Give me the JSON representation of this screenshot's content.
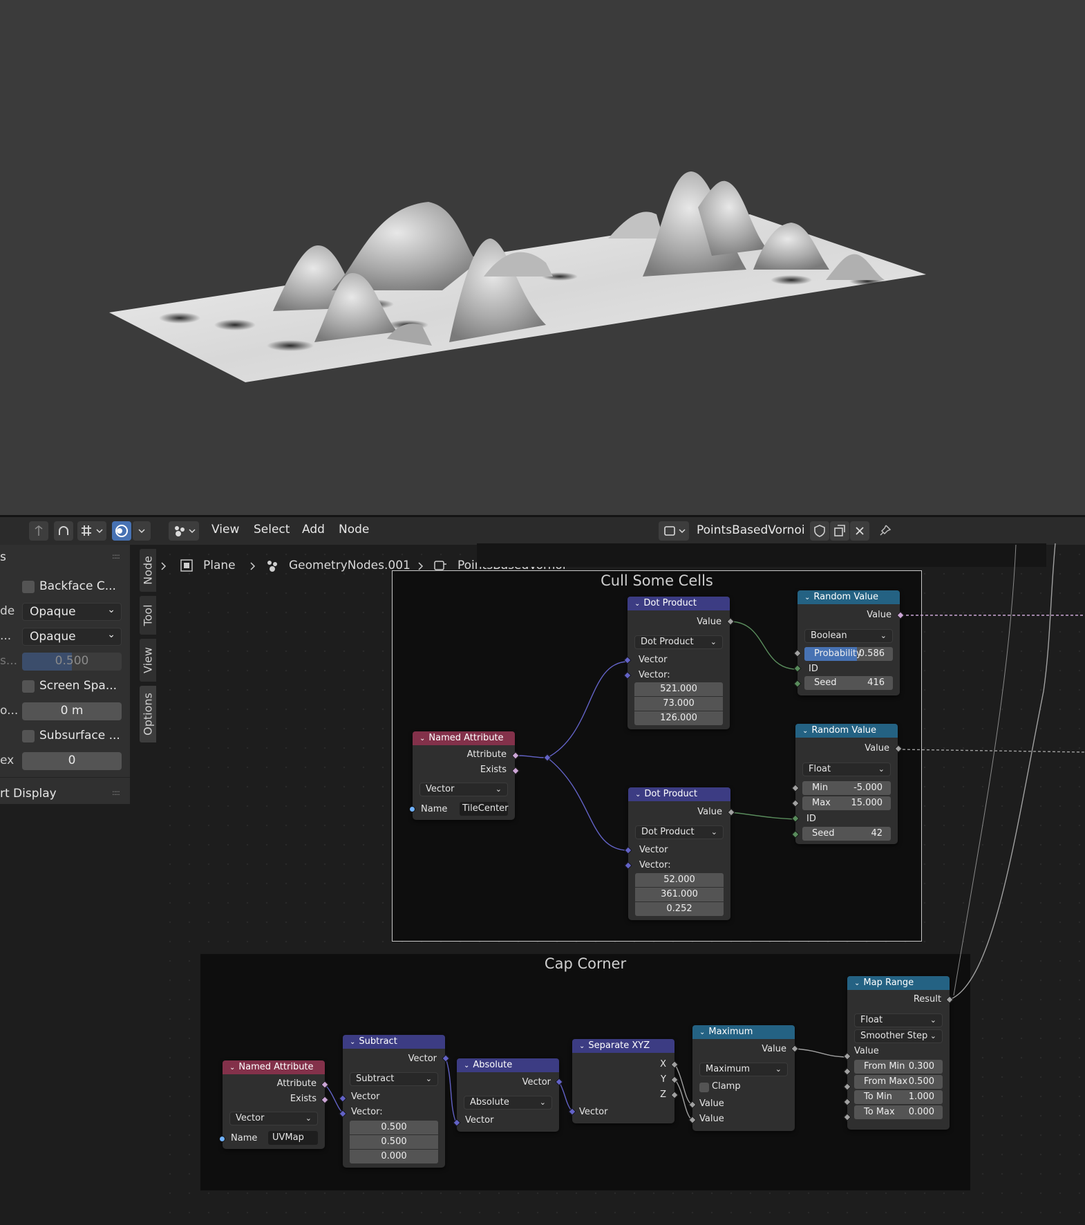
{
  "header": {
    "menus": [
      "View",
      "Select",
      "Add",
      "Node"
    ],
    "tree_name": "PointsBasedVornoi"
  },
  "breadcrumb": {
    "object": "Plane",
    "modifier": "GeometryNodes.001",
    "tree": "PointsBasedVornoi"
  },
  "sidepanel": {
    "title": "s",
    "rows": [
      {
        "label": "",
        "checkbox": "Backface C..."
      },
      {
        "label": "de",
        "value": "Opaque"
      },
      {
        "label": "...",
        "value": "Opaque"
      },
      {
        "label": "s...",
        "value": "0.500"
      },
      {
        "label": "",
        "checkbox": "Screen Spa..."
      },
      {
        "label": "o...",
        "value": "0 m"
      },
      {
        "label": "",
        "checkbox": "Subsurface ..."
      },
      {
        "label": "ex",
        "value": "0"
      }
    ],
    "section2": "rt Display"
  },
  "tabs": [
    "Node",
    "Tool",
    "View",
    "Options"
  ],
  "frames": {
    "cull": "Cull Some Cells",
    "cap": "Cap Corner"
  },
  "nodes": {
    "named_attr1": {
      "title": "Named Attribute",
      "out1": "Attribute",
      "out2": "Exists",
      "type": "Vector",
      "name_label": "Name",
      "name_value": "TileCenter"
    },
    "dot1": {
      "title": "Dot Product",
      "out": "Value",
      "op": "Dot Product",
      "in1": "Vector",
      "in2": "Vector:",
      "v": [
        "521.000",
        "73.000",
        "126.000"
      ]
    },
    "dot2": {
      "title": "Dot Product",
      "out": "Value",
      "op": "Dot Product",
      "in1": "Vector",
      "in2": "Vector:",
      "v": [
        "52.000",
        "361.000",
        "0.252"
      ]
    },
    "rand1": {
      "title": "Random Value",
      "out": "Value",
      "type": "Boolean",
      "prob_label": "Probability",
      "prob_value": "0.586",
      "id": "ID",
      "seed_label": "Seed",
      "seed_value": "416"
    },
    "rand2": {
      "title": "Random Value",
      "out": "Value",
      "type": "Float",
      "min_label": "Min",
      "min_value": "-5.000",
      "max_label": "Max",
      "max_value": "15.000",
      "id": "ID",
      "seed_label": "Seed",
      "seed_value": "42"
    },
    "named_attr2": {
      "title": "Named Attribute",
      "out1": "Attribute",
      "out2": "Exists",
      "type": "Vector",
      "name_label": "Name",
      "name_value": "UVMap"
    },
    "subtract": {
      "title": "Subtract",
      "out": "Vector",
      "op": "Subtract",
      "in1": "Vector",
      "in2": "Vector:",
      "v": [
        "0.500",
        "0.500",
        "0.000"
      ]
    },
    "absolute": {
      "title": "Absolute",
      "out": "Vector",
      "op": "Absolute",
      "in1": "Vector"
    },
    "sepxyz": {
      "title": "Separate XYZ",
      "x": "X",
      "y": "Y",
      "z": "Z",
      "in1": "Vector"
    },
    "maximum": {
      "title": "Maximum",
      "out": "Value",
      "op": "Maximum",
      "clamp": "Clamp",
      "in1": "Value",
      "in2": "Value"
    },
    "maprange": {
      "title": "Map Range",
      "out": "Result",
      "type": "Float",
      "interp": "Smoother Step",
      "in": "Value",
      "from_min_label": "From Min",
      "from_min": "0.300",
      "from_max_label": "From Max",
      "from_max": "0.500",
      "to_min_label": "To Min",
      "to_min": "1.000",
      "to_max_label": "To Max",
      "to_max": "0.000"
    }
  },
  "colors": {
    "vector_header": "#3c3c83",
    "attribute_header": "#83314a",
    "converter_header": "#246283",
    "frame_bg": "#0e0e0e"
  }
}
